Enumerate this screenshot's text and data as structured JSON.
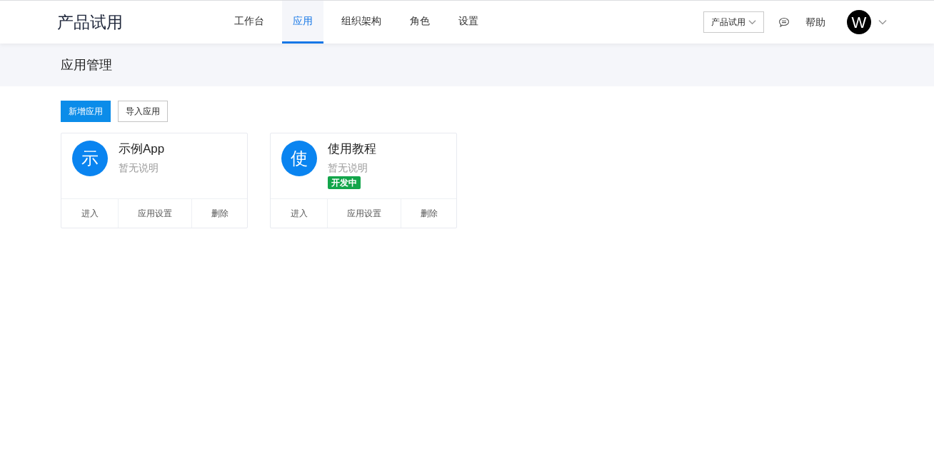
{
  "logo": "产品试用",
  "nav": [
    {
      "label": "工作台",
      "selected": false
    },
    {
      "label": "应用",
      "selected": true
    },
    {
      "label": "组织架构",
      "selected": false
    },
    {
      "label": "角色",
      "selected": false
    },
    {
      "label": "设置",
      "selected": false
    }
  ],
  "org_select": {
    "value": "产品试用"
  },
  "help": "帮助",
  "avatar": "W",
  "page_title": "应用管理",
  "actions": [
    {
      "label": "新增应用",
      "kind": "primary"
    },
    {
      "label": "导入应用",
      "kind": "default"
    }
  ],
  "apps": [
    {
      "icon_text": "示",
      "name": "示例App",
      "description": "暂无说明",
      "actions": [
        "进入",
        "应用设置",
        "删除"
      ]
    },
    {
      "icon_text": "使",
      "name": "使用教程",
      "description": "暂无说明",
      "tag": "开发中",
      "actions": [
        "进入",
        "应用设置",
        "删除"
      ]
    }
  ]
}
